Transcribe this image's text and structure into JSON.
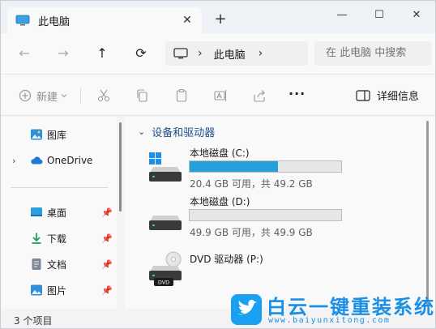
{
  "tab": {
    "title": "此电脑",
    "close": "✕",
    "new_tab": "+"
  },
  "window_controls": {
    "minimize": "—",
    "maximize": "☐",
    "close": "✕"
  },
  "nav": {
    "back": "←",
    "forward": "→",
    "up": "↑",
    "refresh": "⟳"
  },
  "address": {
    "separator": "›",
    "crumb": "此电脑",
    "separator2": "›"
  },
  "search": {
    "placeholder": "在 此电脑 中搜索"
  },
  "command_bar": {
    "new_label": "新建",
    "more": "···",
    "details_label": "详细信息",
    "icons": [
      "new-icon",
      "cut-icon",
      "copy-icon",
      "paste-icon",
      "rename-icon",
      "share-icon",
      "delete-icon"
    ]
  },
  "sidebar": {
    "items": [
      {
        "label": "图库",
        "icon": "gallery-icon",
        "expandable": false,
        "pinned": false
      },
      {
        "label": "OneDrive",
        "icon": "cloud-icon",
        "expandable": true,
        "pinned": false
      },
      {
        "label": "桌面",
        "icon": "desktop-icon",
        "expandable": false,
        "pinned": true
      },
      {
        "label": "下载",
        "icon": "download-icon",
        "expandable": false,
        "pinned": true
      },
      {
        "label": "文档",
        "icon": "document-icon",
        "expandable": false,
        "pinned": true
      },
      {
        "label": "图片",
        "icon": "pictures-icon",
        "expandable": false,
        "pinned": true
      }
    ]
  },
  "main": {
    "group_title": "设备和驱动器",
    "drives": [
      {
        "name": "本地磁盘 (C:)",
        "free_text": "20.4 GB 可用，共 49.2 GB",
        "used_fraction": 0.585,
        "icon": "windows-drive-icon"
      },
      {
        "name": "本地磁盘 (D:)",
        "free_text": "49.9 GB 可用，共 49.9 GB",
        "used_fraction": 0.0,
        "icon": "hard-drive-icon"
      },
      {
        "name": "DVD 驱动器 (P:)",
        "free_text": "",
        "icon": "dvd-drive-icon",
        "badge": "DVD"
      }
    ]
  },
  "status": {
    "text": "3 个项目"
  },
  "watermark": {
    "text": "白云一键重装系统",
    "url": "www.baiyunxitong.com"
  },
  "colors": {
    "accent": "#26a0da",
    "group_header": "#1f4e8c",
    "watermark": "#1a8fe6"
  }
}
